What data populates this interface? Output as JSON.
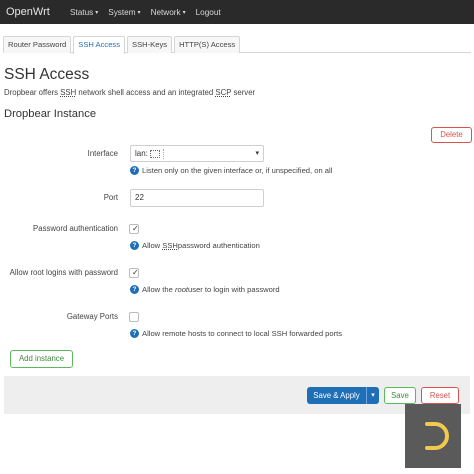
{
  "navbar": {
    "brand": "OpenWrt",
    "items": [
      {
        "label": "Status",
        "has_caret": true
      },
      {
        "label": "System",
        "has_caret": true
      },
      {
        "label": "Network",
        "has_caret": true
      },
      {
        "label": "Logout",
        "has_caret": false
      }
    ],
    "caret_icon": "▾"
  },
  "tabs": [
    {
      "label": "Router Password",
      "active": false
    },
    {
      "label": "SSH Access",
      "active": true
    },
    {
      "label": "SSH-Keys",
      "active": false
    },
    {
      "label": "HTTP(S) Access",
      "active": false
    }
  ],
  "page": {
    "title": "SSH Access",
    "description_parts": [
      "Dropbear offers ",
      "SSH",
      " network shell access and an integrated ",
      "SCP",
      " server"
    ],
    "section_title": "Dropbear Instance",
    "delete_label": "Delete"
  },
  "form": {
    "interface": {
      "label": "Interface",
      "value": "lan:",
      "dropdown_icon": "▾",
      "help": "Listen only on the given interface or, if unspecified, on all"
    },
    "port": {
      "label": "Port",
      "value": "22"
    },
    "password_auth": {
      "label": "Password authentication",
      "checked": true,
      "help_parts": [
        "Allow ",
        "SSH",
        " password authentication"
      ]
    },
    "root_login": {
      "label": "Allow root logins with password",
      "checked": true,
      "help_parts": [
        "Allow the ",
        "root",
        " user to login with password"
      ]
    },
    "gateway_ports": {
      "label": "Gateway Ports",
      "checked": false,
      "help": "Allow remote hosts to connect to local SSH forwarded ports"
    },
    "help_icon": "?",
    "check_glyph": "✓"
  },
  "add_instance_label": "Add instance",
  "footer": {
    "save_apply_label": "Save & Apply",
    "save_apply_dropdown_icon": "▾",
    "save_label": "Save",
    "reset_label": "Reset"
  },
  "colors": {
    "navbar_bg": "#2a2a2a",
    "primary": "#1f6fb7",
    "success": "#5cb85c",
    "danger": "#d9534f"
  }
}
